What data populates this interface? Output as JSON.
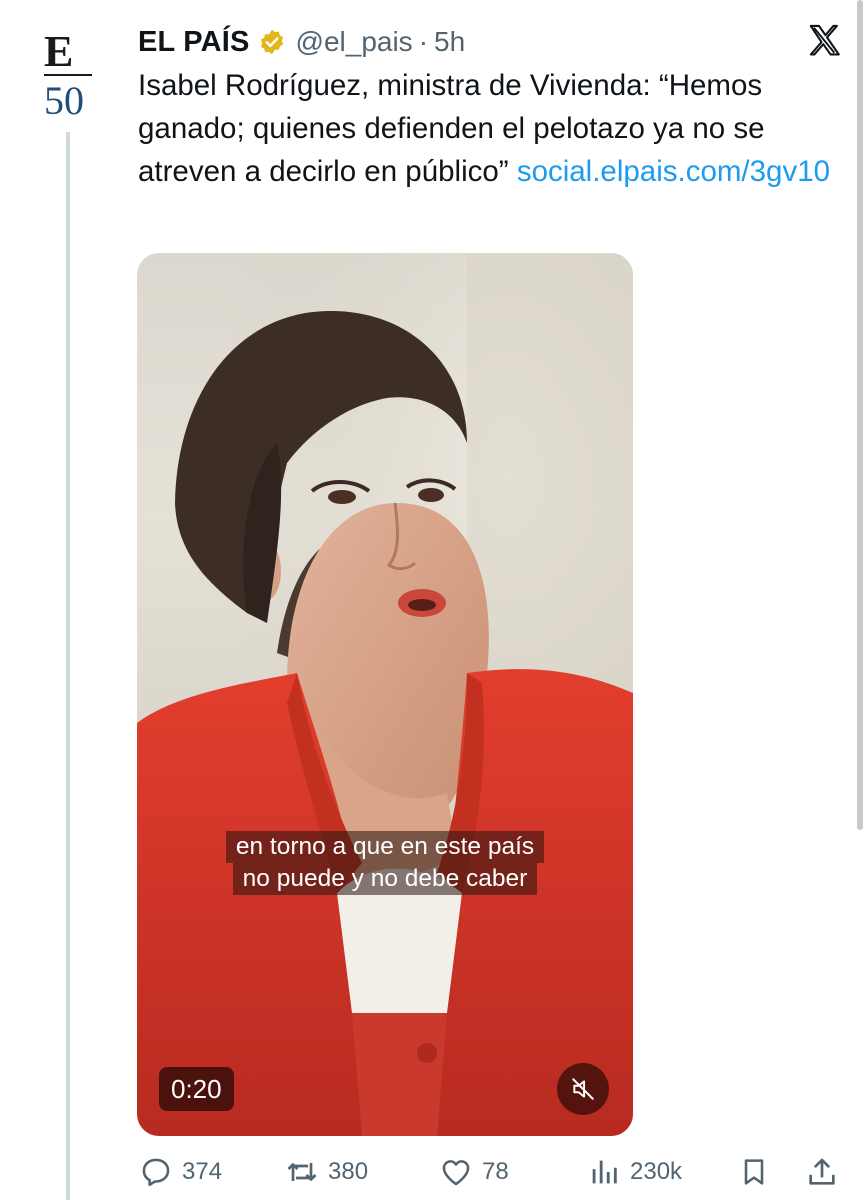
{
  "account": {
    "display_name": "EL PAÍS",
    "handle": "@el_pais",
    "separator": "·",
    "time": "5h",
    "avatar_label": "E 50",
    "verified_badge": "gold-verified-icon",
    "brand_color": "#1d4f7a"
  },
  "tweet": {
    "text": "Isabel Rodríguez, ministra de Vivienda: “Hemos ganado; quienes defienden el pelotazo ya no se atreven a decirlo en público”",
    "link_text": "social.elpais.com/3gv10"
  },
  "video": {
    "subtitle_lines": [
      "en torno a que en este país",
      "no puede y no debe caber"
    ],
    "duration": "0:20",
    "mute_icon": "muted-speaker-icon"
  },
  "actions": {
    "replies": "374",
    "reposts": "380",
    "likes": "78",
    "views": "230k"
  },
  "colors": {
    "link": "#1d9bf0",
    "secondary_text": "#536471",
    "jacket": "#d9362a",
    "verified_gold": "#e2b719"
  },
  "platform_logo": "x-logo-icon"
}
